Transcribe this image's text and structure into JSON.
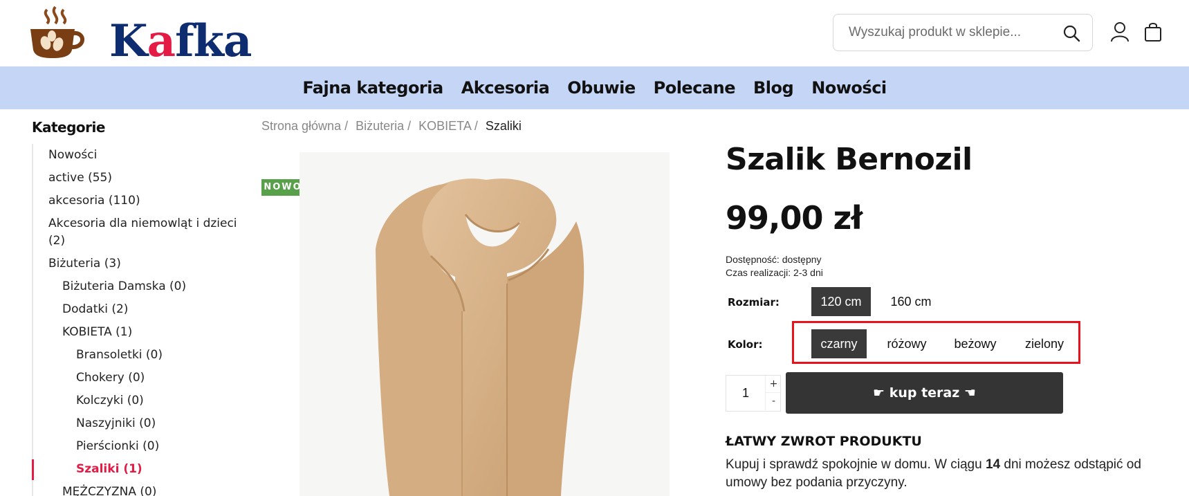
{
  "header": {
    "logo_text_k": "K",
    "logo_text_a": "a",
    "logo_text_rest": "fka",
    "search_placeholder": "Wyszukaj produkt w sklepie..."
  },
  "nav": {
    "items": [
      "Fajna kategoria",
      "Akcesoria",
      "Obuwie",
      "Polecane",
      "Blog",
      "Nowości"
    ]
  },
  "sidebar": {
    "title": "Kategorie",
    "items": [
      {
        "label": "Nowości"
      },
      {
        "label": "active (55)"
      },
      {
        "label": "akcesoria (110)"
      },
      {
        "label": "Akcesoria dla niemowląt i dzieci (2)"
      },
      {
        "label": "Biżuteria (3)"
      },
      {
        "label": "Biżuteria Damska (0)"
      },
      {
        "label": "Dodatki (2)"
      },
      {
        "label": "KOBIETA (1)"
      },
      {
        "label": "Bransoletki (0)"
      },
      {
        "label": "Chokery (0)"
      },
      {
        "label": "Kolczyki (0)"
      },
      {
        "label": "Naszyjniki (0)"
      },
      {
        "label": "Pierścionki (0)"
      },
      {
        "label": "Szaliki (1)"
      },
      {
        "label": "MĘŻCZYZNA (0)"
      }
    ]
  },
  "breadcrumb": {
    "items": [
      "Strona główna /",
      "Biżuteria /",
      "KOBIETA /"
    ],
    "current": "Szaliki"
  },
  "product": {
    "badge": "NOWOŚĆ",
    "title": "Szalik Bernozil",
    "price": "99,00 zł",
    "availability": "Dostępność: dostępny",
    "lead_time": "Czas realizacji: 2-3 dni",
    "size_label": "Rozmiar:",
    "sizes": [
      "120 cm",
      "160 cm"
    ],
    "selected_size": "120 cm",
    "color_label": "Kolor:",
    "colors": [
      "czarny",
      "różowy",
      "beżowy",
      "zielony"
    ],
    "selected_color": "czarny",
    "quantity": "1",
    "qty_plus": "+",
    "qty_minus": "-",
    "buy_label": "☛ kup teraz ☚",
    "image_color": "#d9b48c"
  },
  "returns": {
    "title": "ŁATWY ZWROT PRODUKTU",
    "text_before": "Kupuj i sprawdź spokojnie w domu. W ciągu ",
    "days": "14",
    "text_after": " dni możesz odstąpić od umowy bez podania przyczyny."
  },
  "colors": {
    "nav_bg": "#c5d5f5",
    "brand_blue": "#0e2c70",
    "brand_red": "#e41b45",
    "badge_green": "#58a14a",
    "highlight_red": "#e8121c",
    "button_dark": "#343434"
  }
}
